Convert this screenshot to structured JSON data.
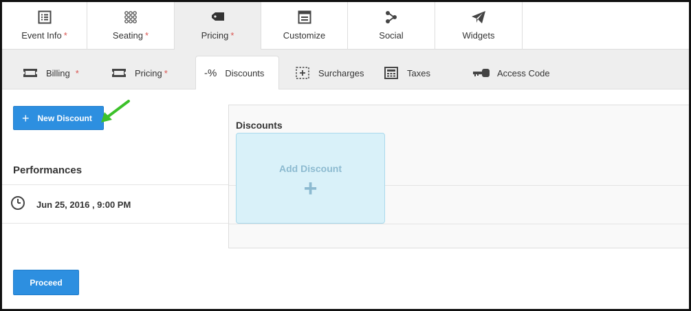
{
  "top_tabs": [
    {
      "label": "Event Info",
      "required": "*",
      "icon": "list-icon"
    },
    {
      "label": "Seating",
      "required": "*",
      "icon": "seat-grid-icon"
    },
    {
      "label": "Pricing",
      "required": "*",
      "icon": "tag-icon",
      "active": true
    },
    {
      "label": "Customize",
      "required": "",
      "icon": "window-icon"
    },
    {
      "label": "Social",
      "required": "",
      "icon": "share-icon"
    },
    {
      "label": "Widgets",
      "required": "",
      "icon": "paper-plane-icon"
    }
  ],
  "sub_tabs": [
    {
      "label": "Billing",
      "required": "*",
      "icon": "ticket-icon"
    },
    {
      "label": "Pricing",
      "required": "*",
      "icon": "ticket-icon"
    },
    {
      "label": "Discounts",
      "required": "",
      "icon": "percent-icon",
      "icon_text": "-%",
      "active": true
    },
    {
      "label": "Surcharges",
      "required": "",
      "icon": "plus-box-icon"
    },
    {
      "label": "Taxes",
      "required": "",
      "icon": "calculator-icon"
    },
    {
      "label": "Access Code",
      "required": "",
      "icon": "key-icon"
    }
  ],
  "left": {
    "new_discount_label": "New Discount",
    "performances_title": "Performances",
    "performance_date": "Jun 25, 2016 , 9:00 PM",
    "proceed_label": "Proceed"
  },
  "discounts": {
    "title": "Discounts",
    "add_label": "Add Discount",
    "add_symbol": "+"
  },
  "colors": {
    "primary": "#2d8fe0",
    "required": "#d9534f",
    "add_card_bg": "#d9f1f9",
    "arrow": "#4cd137"
  }
}
